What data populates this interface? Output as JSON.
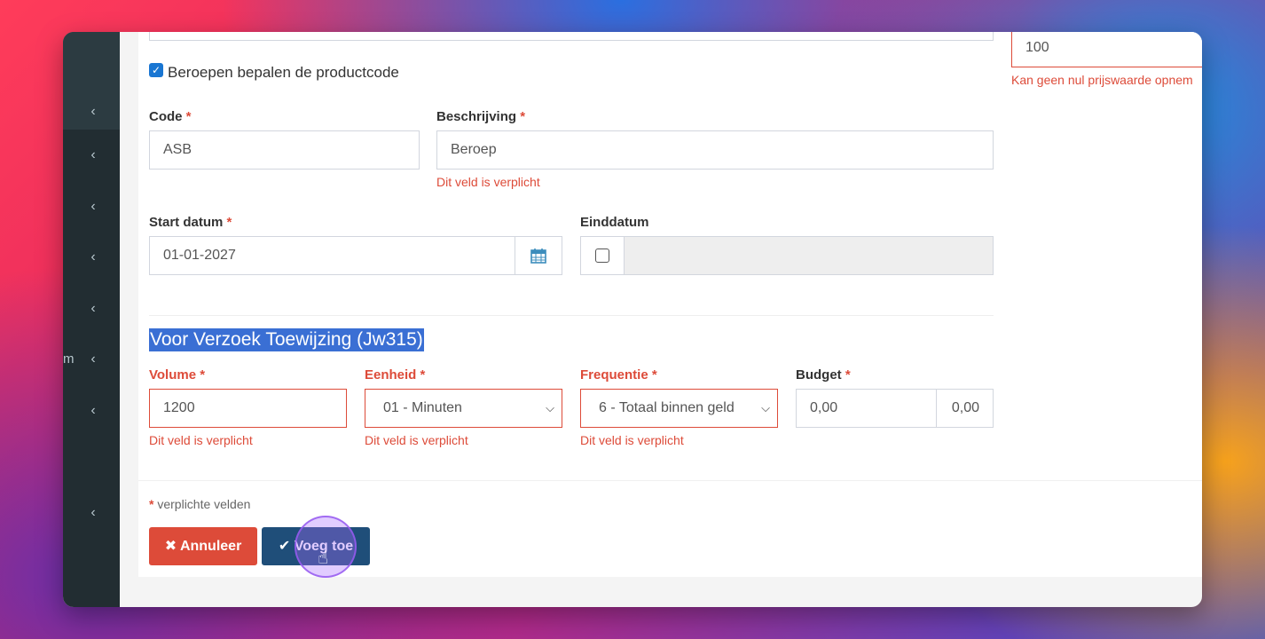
{
  "form": {
    "checkbox_label": "Beroepen bepalen de productcode",
    "code": {
      "label": "Code",
      "required": "*",
      "value": "ASB"
    },
    "beschrijving": {
      "label": "Beschrijving",
      "required": "*",
      "value": "Beroep",
      "error": "Dit veld is verplicht"
    },
    "start_datum": {
      "label": "Start datum",
      "required": "*",
      "value": "01-01-2027"
    },
    "einddatum": {
      "label": "Einddatum"
    },
    "section_title": "Voor Verzoek Toewijzing (Jw315)",
    "volume": {
      "label": "Volume",
      "required": "*",
      "value": "1200",
      "error": "Dit veld is verplicht"
    },
    "eenheid": {
      "label": "Eenheid",
      "required": "*",
      "value": "01 - Minuten",
      "error": "Dit veld is verplicht"
    },
    "frequentie": {
      "label": "Frequentie",
      "required": "*",
      "value": "6 - Totaal binnen geld",
      "error": "Dit veld is verplicht"
    },
    "budget": {
      "label": "Budget",
      "required": "*",
      "value": "0,00",
      "addon": "0,00"
    },
    "required_note_star": "*",
    "required_note": "verplichte velden"
  },
  "right_panel": {
    "value": "100",
    "error": "Kan geen nul prijswaarde opnem"
  },
  "buttons": {
    "cancel": "Annuleer",
    "add": "Voeg toe"
  },
  "sidebar": {
    "letter": "m"
  },
  "colors": {
    "error": "#dd4b39",
    "primary_button": "#1f4e79",
    "danger_button": "#dd4b39",
    "sidebar": "#222d32",
    "selection": "#3a6fd4"
  }
}
